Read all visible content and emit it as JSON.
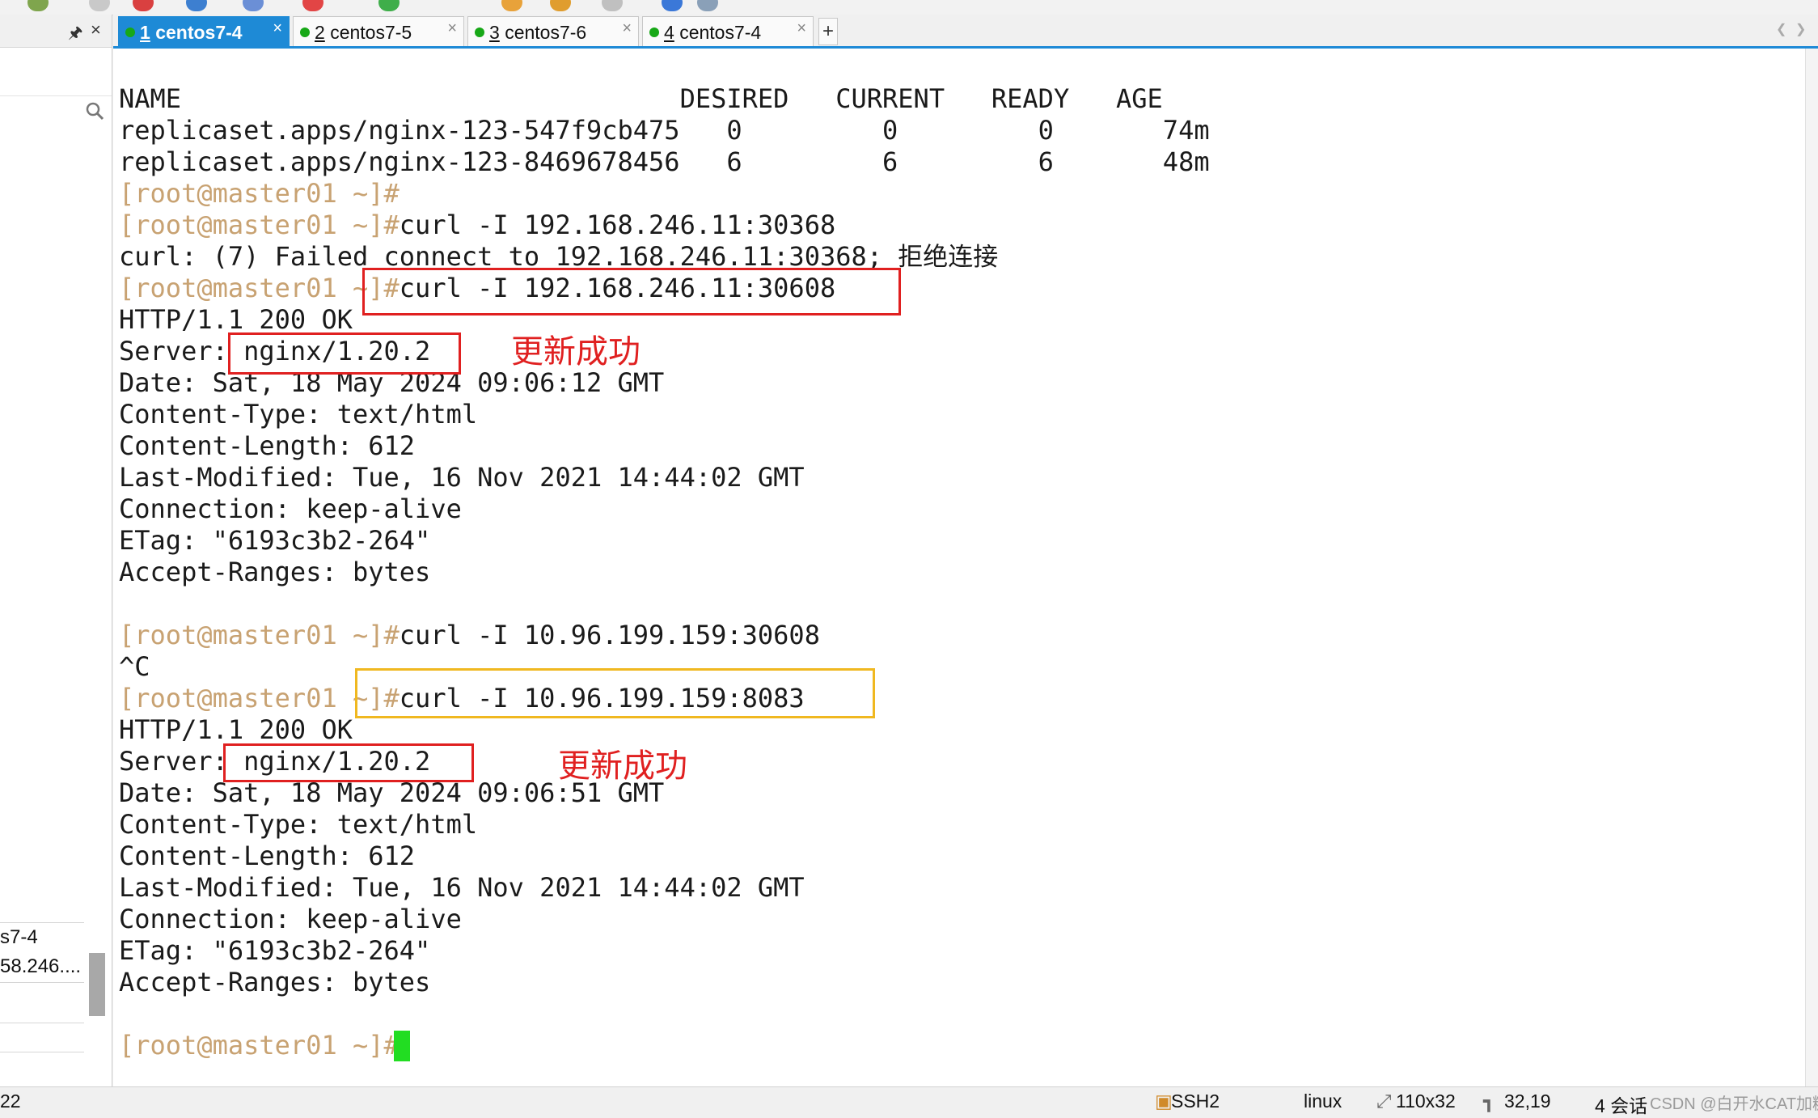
{
  "panel": {
    "sessions": [
      "s7-4",
      "58.246...."
    ],
    "status_left": "22"
  },
  "tabs": [
    {
      "num": "1",
      "name": "centos7-4"
    },
    {
      "num": "2",
      "name": "centos7-5"
    },
    {
      "num": "3",
      "name": "centos7-6"
    },
    {
      "num": "4",
      "name": "centos7-4"
    }
  ],
  "tab_add": "+",
  "terminal": {
    "prompt": "[root@master01 ~]#",
    "lines": {
      "l1": "NAME                                DESIRED   CURRENT   READY   AGE",
      "l2": "replicaset.apps/nginx-123-547f9cb475   0         0         0       74m",
      "l3": "replicaset.apps/nginx-123-8469678456   6         6         6       48m",
      "l5": "curl -I 192.168.246.11:30368",
      "l6a": "curl: (7) Failed connect to 192.168.246.11:30368; ",
      "l6b": "拒绝连接",
      "l7": "curl -I 192.168.246.11:30608",
      "l8": "HTTP/1.1 200 OK",
      "l9": "Server: nginx/1.20.2",
      "l10": "Date: Sat, 18 May 2024 09:06:12 GMT",
      "l11": "Content-Type: text/html",
      "l12": "Content-Length: 612",
      "l13": "Last-Modified: Tue, 16 Nov 2021 14:44:02 GMT",
      "l14": "Connection: keep-alive",
      "l15": "ETag: \"6193c3b2-264\"",
      "l16": "Accept-Ranges: bytes",
      "l18": "curl -I 10.96.199.159:30608",
      "l19": "^C",
      "l20": "curl -I 10.96.199.159:8083",
      "l21": "HTTP/1.1 200 OK",
      "l22": "Server: nginx/1.20.2",
      "l23": "Date: Sat, 18 May 2024 09:06:51 GMT",
      "l24": "Content-Type: text/html",
      "l25": "Content-Length: 612",
      "l26": "Last-Modified: Tue, 16 Nov 2021 14:44:02 GMT",
      "l27": "Connection: keep-alive",
      "l28": "ETag: \"6193c3b2-264\"",
      "l29": "Accept-Ranges: bytes"
    }
  },
  "annotations": {
    "note1": "更新成功",
    "note2": "更新成功"
  },
  "status": {
    "protocol": "SSH2",
    "os": "linux",
    "size": "110x32",
    "pos": "32,19",
    "sessions": "4 会话"
  },
  "watermark": "CSDN @白开水CAT加糖U",
  "colors": {
    "accent": "#1e8ad6",
    "prompt": "#c8a272",
    "annotation": "#e02020",
    "highlight_yellow": "#f0b820",
    "cursor": "#22dd22"
  },
  "icons": [
    "pin-icon",
    "close-icon",
    "search-icon",
    "status-dot-icon",
    "cursor-block"
  ]
}
